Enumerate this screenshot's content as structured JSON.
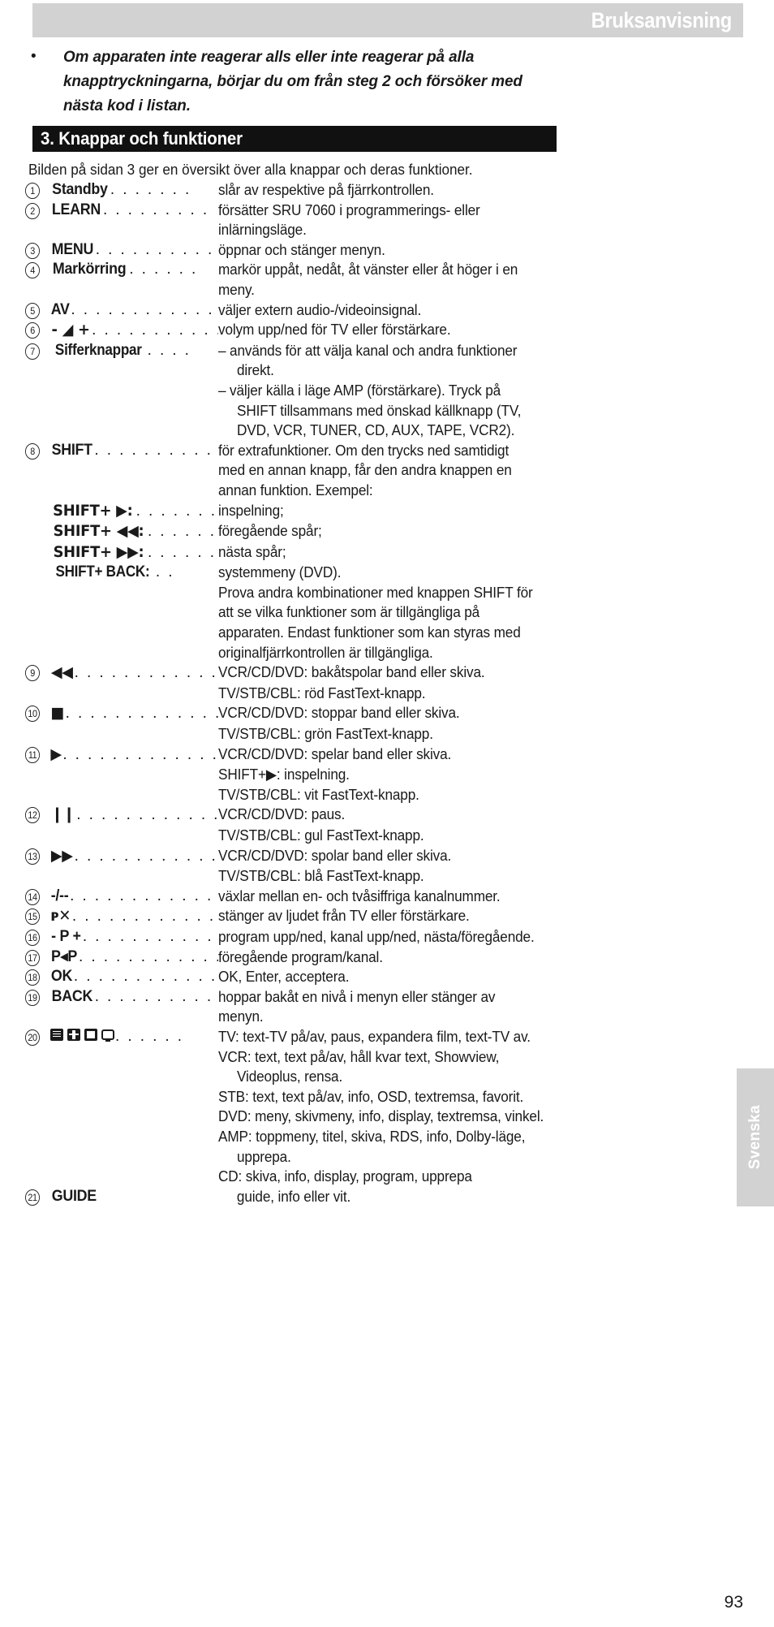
{
  "header": {
    "title": "Bruksanvisning"
  },
  "intro": {
    "bullet": "•",
    "lines": [
      "Om apparaten inte reagerar alls eller inte reagerar på alla",
      "knapptryckningarna, börjar du om från steg 2 och försöker med",
      "nästa kod i listan."
    ]
  },
  "section": {
    "title": "3. Knappar och funktioner",
    "lead": "Bilden på sidan 3 ger en översikt över alla knappar och deras funktioner."
  },
  "entries": [
    {
      "num": "1",
      "key_icon": "power-standby-icon",
      "key": "Standby",
      "dots": ". . . . . . .",
      "desc": "slår av respektive på fjärrkontrollen.",
      "cont": []
    },
    {
      "num": "2",
      "key": "LEARN",
      "dots": ". . . . . . . . .",
      "desc": "försätter SRU 7060 i programmerings- eller",
      "cont": [
        {
          "text": "inlärningsläge.",
          "deep": false
        }
      ]
    },
    {
      "num": "3",
      "key": "MENU",
      "dots": ". . . . . . . . . .",
      "desc": "öppnar och stänger menyn.",
      "cont": []
    },
    {
      "num": "4",
      "key": "Markörring",
      "dots": ". . . . . .",
      "desc": "markör uppåt, nedåt, åt vänster eller åt höger i en",
      "cont": [
        {
          "text": "meny.",
          "deep": false
        }
      ]
    },
    {
      "num": "5",
      "key": "AV",
      "dots": ". . . . . . . . . . . . .",
      "desc": "väljer extern audio-/videoinsignal.",
      "cont": []
    },
    {
      "num": "6",
      "key_icon": "volume-icon",
      "key": "- ◢ +",
      "dots": ". . . . . . . . . . .",
      "desc": "volym upp/ned för TV eller förstärkare.",
      "cont": []
    },
    {
      "num": "7",
      "key": "Sifferknappar",
      "dots": ". . . .",
      "desc": "– används för att välja kanal och andra funktioner",
      "cont": [
        {
          "text": "direkt.",
          "deep": true
        },
        {
          "text": "– väljer källa i läge AMP (förstärkare). Tryck på",
          "deep": false
        },
        {
          "text": "SHIFT tillsammans med önskad källknapp (TV,",
          "deep": true
        },
        {
          "text": "DVD, VCR, TUNER, CD, AUX, TAPE, VCR2).",
          "deep": true
        }
      ]
    },
    {
      "num": "8",
      "key": "SHIFT",
      "dots": ". . . . . . . . . .",
      "desc": "för extrafunktioner. Om den trycks ned samtidigt",
      "cont": [
        {
          "text": "med en annan knapp, får den andra knappen en",
          "deep": false
        },
        {
          "text": "annan funktion. Exempel:",
          "deep": false
        }
      ]
    },
    {
      "num": "",
      "key": "SHIFT+ ▶:",
      "key_icon": "shift-play-combo",
      "dots": ". . . . . . .",
      "desc": "inspelning;",
      "cont": []
    },
    {
      "num": "",
      "key": "SHIFT+ ◀◀:",
      "key_icon": "shift-rewind-combo",
      "dots": ". . . . . .",
      "desc": "föregående spår;",
      "cont": []
    },
    {
      "num": "",
      "key": "SHIFT+ ▶▶:",
      "key_icon": "shift-forward-combo",
      "dots": ". . . . . .",
      "desc": "nästa spår;",
      "cont": []
    },
    {
      "num": "",
      "key": "SHIFT+ BACK:",
      "key_icon": "shift-back-combo",
      "dots": ". .",
      "desc": "systemmeny (DVD).",
      "cont": [
        {
          "text": "Prova andra kombinationer med knappen SHIFT för",
          "deep": false
        },
        {
          "text": "att se vilka funktioner som är tillgängliga på",
          "deep": false
        },
        {
          "text": "apparaten. Endast funktioner som kan styras med",
          "deep": false
        },
        {
          "text": "originalfjärrkontrollen är tillgängliga.",
          "deep": false
        }
      ]
    },
    {
      "num": "9",
      "key": "◀◀",
      "key_icon": "rewind-icon",
      "dots": ". . . . . . . . . . . . . .",
      "desc": "VCR/CD/DVD: bakåtspolar band eller skiva.",
      "cont": [
        {
          "text": "TV/STB/CBL: röd FastText-knapp.",
          "deep": false
        }
      ]
    },
    {
      "num": "10",
      "key": "■",
      "key_icon": "stop-icon",
      "dots": ". . . . . . . . . . . . . .",
      "desc": "VCR/CD/DVD: stoppar band eller skiva.",
      "cont": [
        {
          "text": "TV/STB/CBL: grön FastText-knapp.",
          "deep": false
        }
      ]
    },
    {
      "num": "11",
      "key": "▶",
      "key_icon": "play-icon",
      "dots": ". . . . . . . . . . . . . .",
      "desc": "VCR/CD/DVD: spelar band eller skiva.",
      "cont": [
        {
          "text": "SHIFT+▶: inspelning.",
          "deep": false
        },
        {
          "text": "TV/STB/CBL: vit FastText-knapp.",
          "deep": false
        }
      ]
    },
    {
      "num": "12",
      "key": "❙❙",
      "key_icon": "pause-icon",
      "dots": ". . . . . . . . . . . . . .",
      "desc": "VCR/CD/DVD: paus.",
      "cont": [
        {
          "text": "TV/STB/CBL: gul FastText-knapp.",
          "deep": false
        }
      ]
    },
    {
      "num": "13",
      "key": "▶▶",
      "key_icon": "fast-forward-icon",
      "dots": ". . . . . . . . . . . . .",
      "desc": "VCR/CD/DVD: spolar band eller skiva.",
      "cont": [
        {
          "text": "TV/STB/CBL: blå FastText-knapp.",
          "deep": false
        }
      ]
    },
    {
      "num": "14",
      "key": "-/--",
      "dots": ". . . . . . . . . . . . . .",
      "desc": "växlar mellan en- och tvåsiffriga kanalnummer.",
      "cont": []
    },
    {
      "num": "15",
      "key": "ᴘ✕",
      "key_icon": "mute-icon",
      "dots": ". . . . . . . . . . . . . .",
      "desc": "stänger av ljudet från TV eller förstärkare.",
      "cont": []
    },
    {
      "num": "16",
      "key": "- P +",
      "dots": ". . . . . . . . . . . .",
      "desc": "program upp/ned, kanal upp/ned, nästa/föregående.",
      "cont": []
    },
    {
      "num": "17",
      "key": "P◂P",
      "dots": ". . . . . . . . . . . .",
      "desc": "föregående program/kanal.",
      "cont": []
    },
    {
      "num": "18",
      "key": "OK",
      "dots": ". . . . . . . . . . . . .",
      "desc": "OK, Enter, acceptera.",
      "cont": []
    },
    {
      "num": "19",
      "key": "BACK",
      "dots": ". . . . . . . . . .",
      "desc": "hoppar bakåt en nivå i menyn eller stänger av",
      "cont": [
        {
          "text": "menyn.",
          "deep": false
        }
      ]
    },
    {
      "num": "20",
      "key": "",
      "key_icon": "teletext-icons",
      "dots": ". . . . . .",
      "desc": "TV: text-TV på/av, paus, expandera film, text-TV av.",
      "cont": [
        {
          "text": "VCR: text, text på/av, håll kvar text, Showview,",
          "deep": false
        },
        {
          "text": "Videoplus, rensa.",
          "deep": true
        },
        {
          "text": "STB: text, text på/av, info, OSD, textremsa, favorit.",
          "deep": false
        },
        {
          "text": "DVD: meny, skivmeny, info, display, textremsa, vinkel.",
          "deep": false
        },
        {
          "text": "AMP: toppmeny, titel, skiva, RDS, info, Dolby-läge,",
          "deep": false
        },
        {
          "text": "upprepa.",
          "deep": true
        },
        {
          "text": "CD: skiva, info, display, program, upprepa",
          "deep": false
        }
      ]
    },
    {
      "num": "21",
      "key": "GUIDE",
      "dots": "",
      "desc": "guide, info eller vit.",
      "desc_indent": true,
      "cont": []
    }
  ],
  "side_tab": {
    "label": "Svenska"
  },
  "page_number": "93",
  "colors": {
    "header_band": "#d2d2d2",
    "section_bar": "#111111",
    "text": "#1a1a1a",
    "header_text": "#ffffff"
  }
}
